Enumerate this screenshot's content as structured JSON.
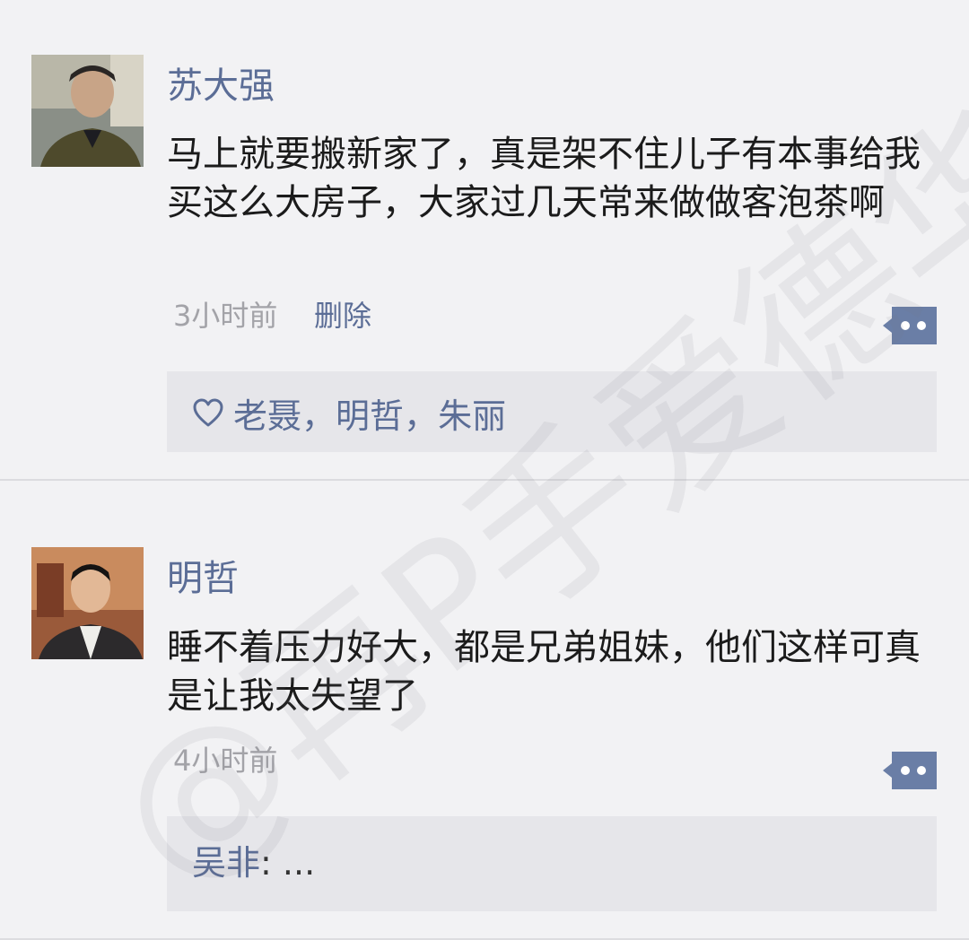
{
  "feed": {
    "posts": [
      {
        "author": "苏大强",
        "text": "马上就要搬新家了，真是架不住儿子有本事给我买这么大房子，大家过几天常来做做客泡茶啊",
        "time": "3小时前",
        "delete_label": "删除",
        "likes": [
          "老聂",
          "明哲",
          "朱丽"
        ],
        "like_separator": "，"
      },
      {
        "author": "明哲",
        "text": "睡不着压力好大，都是兄弟姐妹，他们这样可真是让我太失望了",
        "time": "4小时前",
        "comments": [
          {
            "author": "吴非",
            "separator": ":",
            "text": " ..."
          }
        ]
      }
    ]
  },
  "watermark": {
    "text": "@再P手爱德华"
  },
  "colors": {
    "link": "#5b6d96",
    "background": "#f2f2f4",
    "interaction_bg": "#e6e6ea",
    "time_text": "#a3a3a8",
    "more_button": "#6a7ea6"
  },
  "icons": {
    "more": "comment-more-icon",
    "like": "heart-outline-icon"
  }
}
